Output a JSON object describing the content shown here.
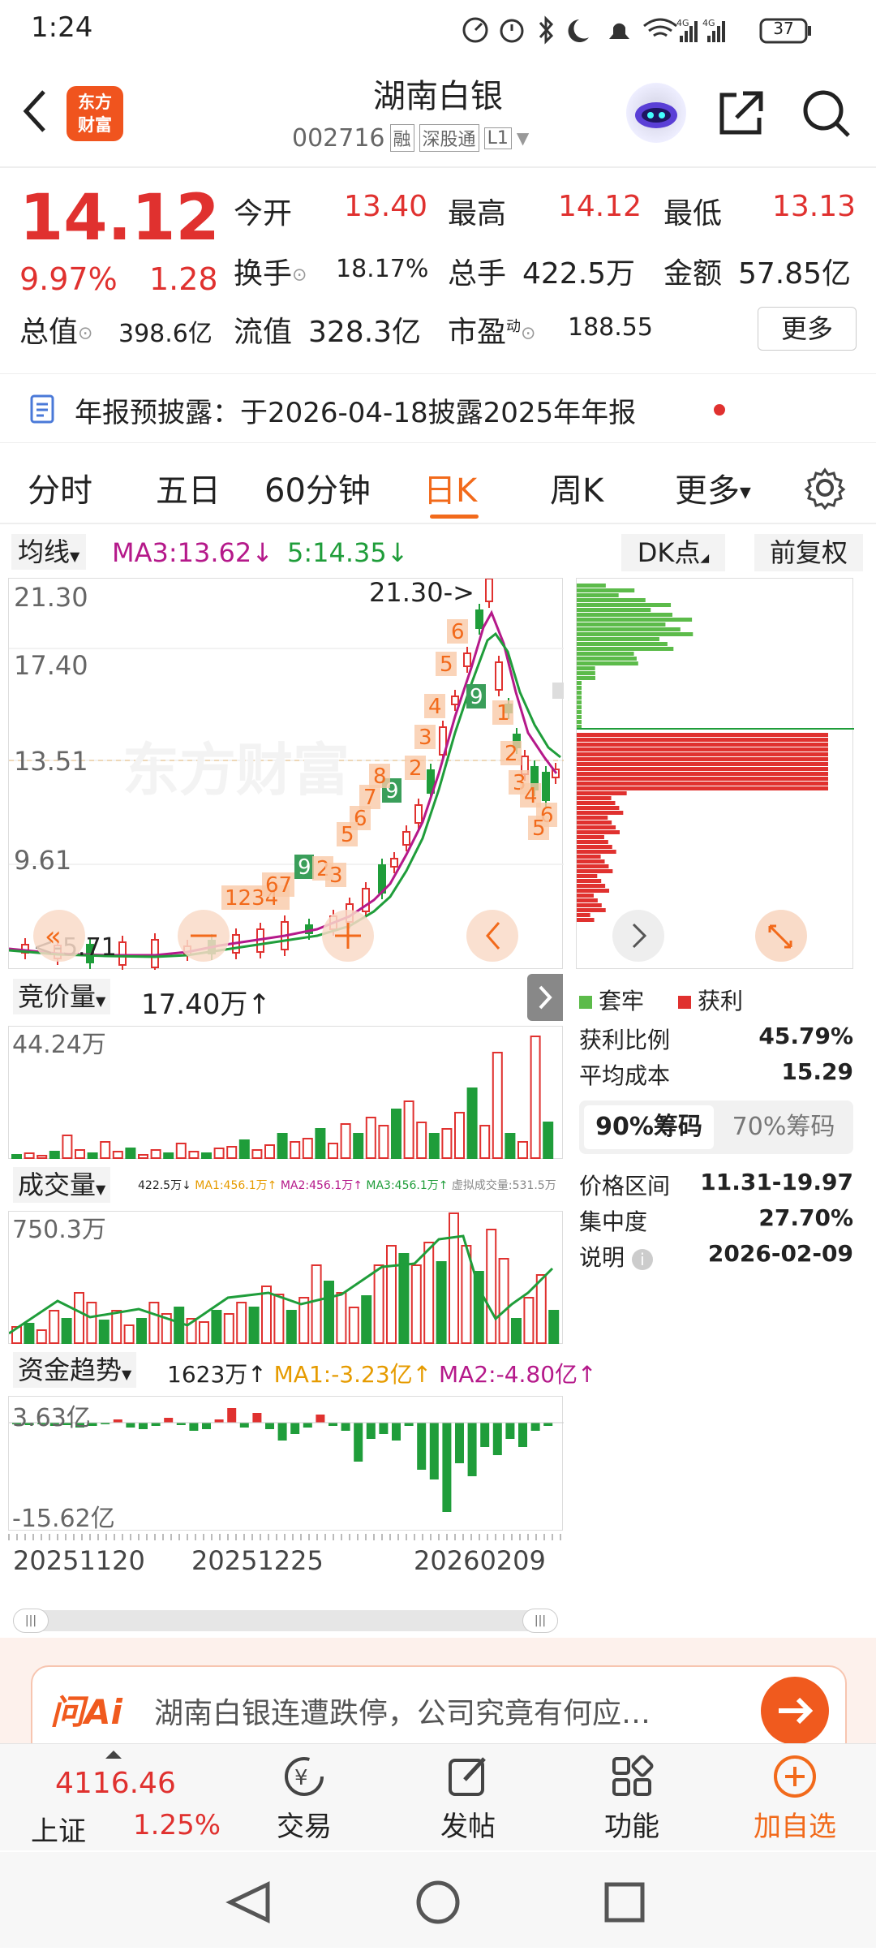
{
  "status_bar": {
    "time": "1:24",
    "battery": "37",
    "net1": "4G",
    "net2": "4G"
  },
  "header": {
    "logo_line1": "东方",
    "logo_line2": "财富",
    "title": "湖南白银",
    "code": "002716",
    "tag1": "融",
    "tag2": "深股通",
    "tag3": "L1"
  },
  "quote": {
    "price": "14.12",
    "change_pct": "9.97%",
    "change": "1.28",
    "open_label": "今开",
    "open": "13.40",
    "high_label": "最高",
    "high": "14.12",
    "low_label": "最低",
    "low": "13.13",
    "turnover_label": "换手",
    "turnover": "18.17%",
    "volume_label": "总手",
    "volume": "422.5万",
    "amount_label": "金额",
    "amount": "57.85亿",
    "mcap_label": "总值",
    "mcap": "398.6亿",
    "float_label": "流值",
    "float": "328.3亿",
    "pe_label": "市盈",
    "pe_sup": "动",
    "pe": "188.55",
    "more": "更多"
  },
  "notice": {
    "text": "年报预披露：于2026-04-18披露2025年年报"
  },
  "tabs": [
    "分时",
    "五日",
    "60分钟",
    "日K",
    "周K",
    "更多"
  ],
  "active_tab": "日K",
  "ma": {
    "label": "均线",
    "ma3": "MA3:13.62",
    "ma5": "5:14.35",
    "dk": "DK点",
    "fq": "前复权"
  },
  "kline": {
    "y_labels": [
      "21.30",
      "17.40",
      "13.51",
      "9.61"
    ],
    "high_note": "21.30->",
    "low_note": "<-5.71"
  },
  "chip": {
    "legend_trapped": "套牢",
    "legend_profit": "获利",
    "profit_ratio_label": "获利比例",
    "profit_ratio": "45.79%",
    "avg_cost_label": "平均成本",
    "avg_cost": "15.29",
    "tab90": "90%筹码",
    "tab70": "70%筹码",
    "range_label": "价格区间",
    "range": "11.31-19.97",
    "conc_label": "集中度",
    "conc": "27.70%",
    "note_label": "说明",
    "note_date": "2026-02-09"
  },
  "bid_volume": {
    "label": "竞价量",
    "value": "17.40万",
    "y_max": "44.24万"
  },
  "volume": {
    "label": "成交量",
    "legend": "422.5万",
    "ma1": "MA1:456.1万",
    "ma2": "MA2:456.1万",
    "ma3": "MA3:456.1万",
    "virtual": "虚拟成交量:531.5万",
    "y_max": "750.3万"
  },
  "fund": {
    "label": "资金趋势",
    "value": "1623万",
    "ma1": "MA1:-3.23亿",
    "ma2": "MA2:-4.80亿",
    "y_max": "3.63亿",
    "y_min": "-15.62亿"
  },
  "dates": [
    "20251120",
    "20251225",
    "20260209"
  ],
  "ai": {
    "brand": "问Ai",
    "prompt": "湖南白银连遭跌停，公司究竟有何应…"
  },
  "bottom_bar": {
    "index_value": "4116.46",
    "index_name": "上证",
    "index_change": "1.25%",
    "trade": "交易",
    "post": "发帖",
    "func": "功能",
    "add": "加自选"
  },
  "colors": {
    "up": "#e0312f",
    "down": "#1f9d3a",
    "accent": "#f26a1b",
    "ma3": "#b5198a"
  }
}
